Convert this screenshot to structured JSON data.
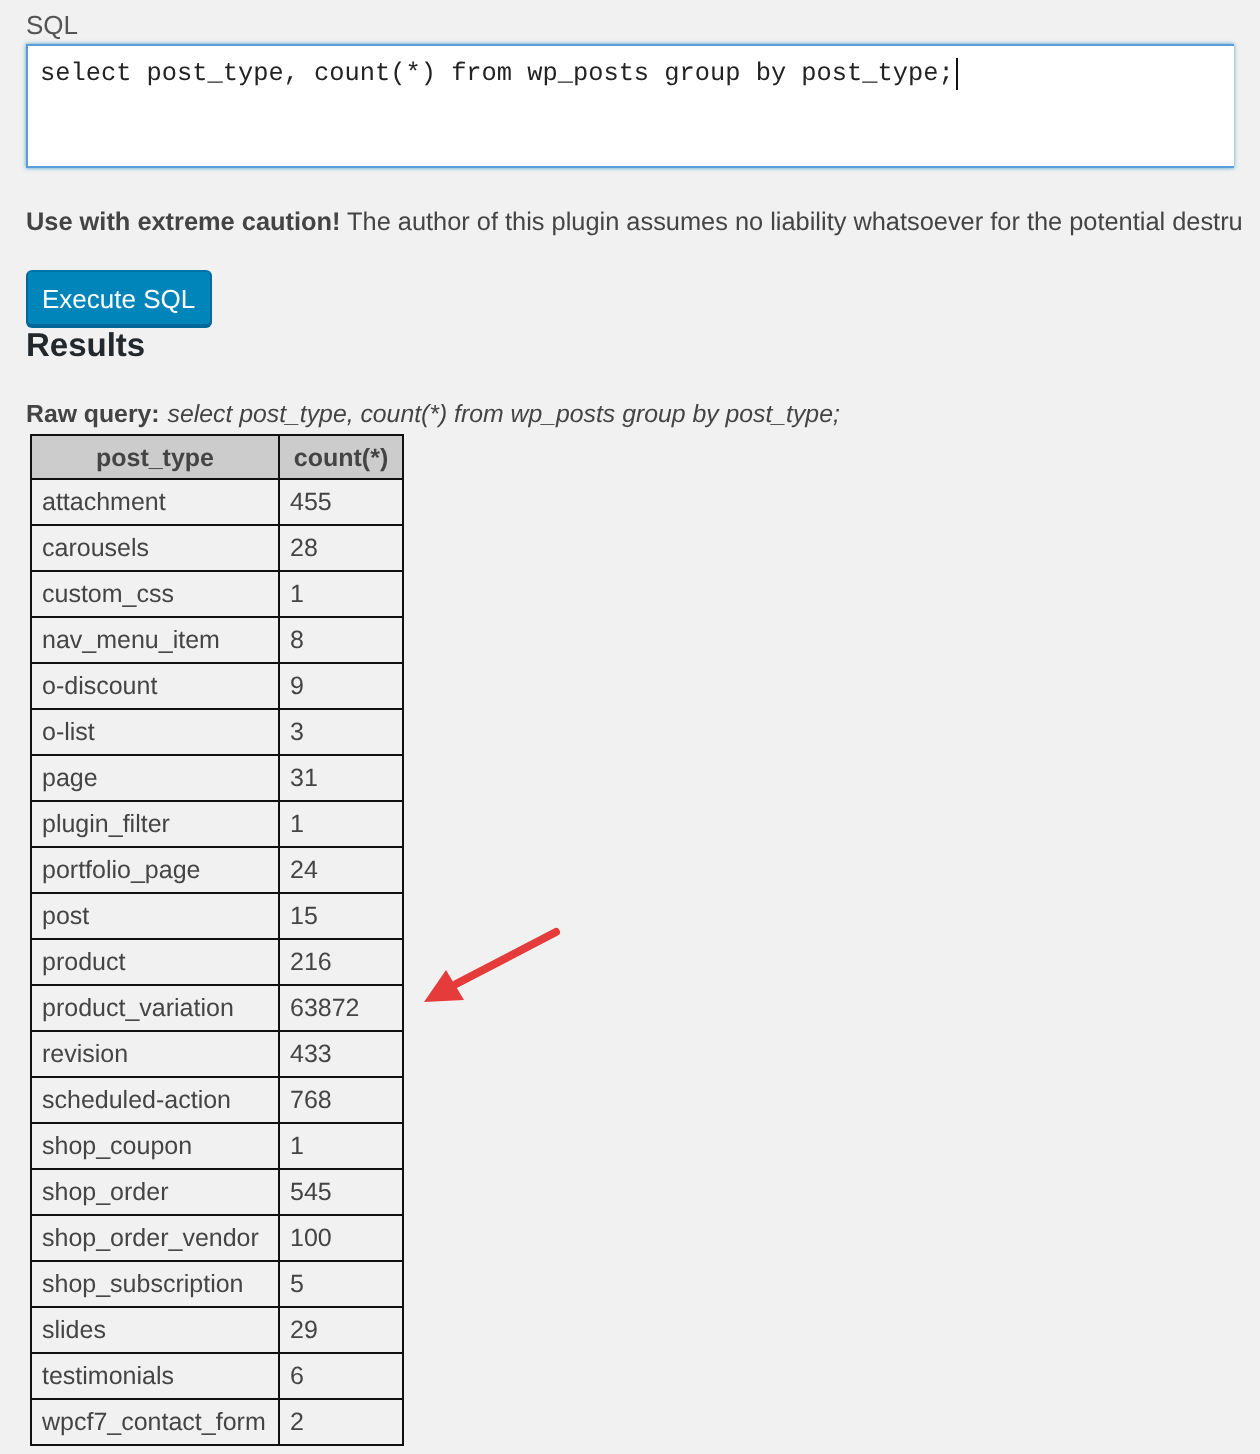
{
  "sql_field": {
    "label": "SQL",
    "value": "select post_type, count(*) from wp_posts group by post_type;",
    "focused": true
  },
  "caution": "**Use with extreme caution!** The author of this plugin assumes no liability whatsoever for the potential destru",
  "execute_button": "Execute SQL",
  "results": {
    "heading": "Results",
    "raw_query": {
      "label": "Raw query:",
      "query": "select post_type, count(*) from wp_posts group by post_type;"
    },
    "table": {
      "columns": [
        "post_type",
        "count(*)"
      ],
      "rows": [
        {
          "cells": [
            "attachment",
            "455"
          ],
          "marked": false
        },
        {
          "cells": [
            "carousels",
            "28"
          ],
          "marked": false
        },
        {
          "cells": [
            "custom_css",
            "1"
          ],
          "marked": false
        },
        {
          "cells": [
            "nav_menu_item",
            "8"
          ],
          "marked": false
        },
        {
          "cells": [
            "o-discount",
            "9"
          ],
          "marked": false
        },
        {
          "cells": [
            "o-list",
            "3"
          ],
          "marked": false
        },
        {
          "cells": [
            "page",
            "31"
          ],
          "marked": false
        },
        {
          "cells": [
            "plugin_filter",
            "1"
          ],
          "marked": false
        },
        {
          "cells": [
            "portfolio_page",
            "24"
          ],
          "marked": false
        },
        {
          "cells": [
            "post",
            "15"
          ],
          "marked": false
        },
        {
          "cells": [
            "product",
            "216"
          ],
          "marked": false
        },
        {
          "cells": [
            "product_variation",
            "63872"
          ],
          "marked": true
        },
        {
          "cells": [
            "revision",
            "433"
          ],
          "marked": false
        },
        {
          "cells": [
            "scheduled-action",
            "768"
          ],
          "marked": false
        },
        {
          "cells": [
            "shop_coupon",
            "1"
          ],
          "marked": false
        },
        {
          "cells": [
            "shop_order",
            "545"
          ],
          "marked": false
        },
        {
          "cells": [
            "shop_order_vendor",
            "100"
          ],
          "marked": false
        },
        {
          "cells": [
            "shop_subscription",
            "5"
          ],
          "marked": false
        },
        {
          "cells": [
            "slides",
            "29"
          ],
          "marked": false
        },
        {
          "cells": [
            "testimonials",
            "6"
          ],
          "marked": false
        },
        {
          "cells": [
            "wpcf7_contact_form",
            "2"
          ],
          "marked": false
        }
      ]
    }
  }
}
